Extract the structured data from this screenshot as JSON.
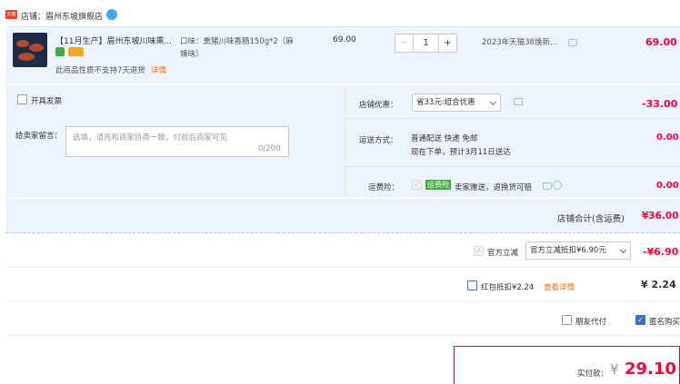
{
  "shop": {
    "badge": "天猫",
    "name": "店铺：眉州东坡旗舰店"
  },
  "item": {
    "title": "【11月生产】眉州东坡川味熏...",
    "notice": "此商品性质不支持7天退货",
    "notice_link": "详情",
    "spec_line1": "口味：熏猪川味香肠150g*2（麻",
    "spec_line2": "辣味）",
    "unit_price": "69.00",
    "quantity": "1",
    "minus": "−",
    "plus": "+",
    "delivery": "2023年天猫38焕新...",
    "subtotal": "69.00"
  },
  "options": {
    "invoice_label": "开具发票",
    "message_label": "给卖家留言：",
    "message_placeholder": "选填，请先和商家协商一致，付款后商家可见",
    "message_count": "0/200"
  },
  "shop_discount": {
    "label": "店铺优惠：",
    "selected": "省33元:组合优惠",
    "amount": "-33.00"
  },
  "shipping": {
    "label": "运送方式：",
    "line1": "普通配送 快递 免邮",
    "line2": "现在下单，预计3月11日送达",
    "amount": "0.00"
  },
  "insurance": {
    "label": "运费险：",
    "tag": "运费险",
    "desc": "卖家赠送，退换货可赔",
    "amount": "0.00"
  },
  "shop_total": {
    "label": "店铺合计(含运费)",
    "value": "¥36.00"
  },
  "official_discount": {
    "label": "官方立减",
    "selected": "官方立减抵扣¥6.90元",
    "amount": "-¥6.90"
  },
  "red_packet": {
    "label": "红包抵扣¥2.24",
    "link": "查看详情",
    "amount": "¥ 2.24"
  },
  "friend_pay": {
    "label": "朋友代付"
  },
  "anonymous": {
    "label": "匿名购买"
  },
  "payment": {
    "label": "实付款：",
    "currency": "¥",
    "value": "29.10"
  }
}
